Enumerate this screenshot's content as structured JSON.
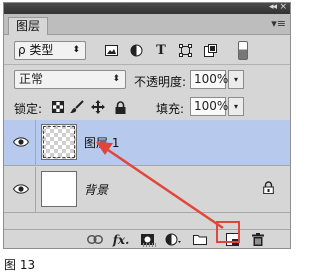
{
  "panel": {
    "tab_label": "图层",
    "collapse_glyph": "◂◂",
    "close_glyph": "×",
    "menu_glyph": "▾≡"
  },
  "filter": {
    "kind_label": "ρ 类型",
    "chevron": "⬍",
    "icons": [
      "image-filter-icon",
      "adjustment-filter-icon",
      "type-filter-icon",
      "shape-filter-icon",
      "smart-object-filter-icon"
    ]
  },
  "blend": {
    "mode": "正常",
    "chevron": "⬍",
    "opacity_label": "不透明度:",
    "opacity_value": "100%",
    "fill_label": "填充:",
    "fill_value": "100%",
    "dropdown_glyph": "▾"
  },
  "lock": {
    "label": "锁定:",
    "icons": [
      "lock-transparent-icon",
      "lock-brush-icon",
      "lock-move-icon",
      "lock-all-icon"
    ]
  },
  "layers": [
    {
      "name": "图层 1",
      "selected": true,
      "thumbnail": "transparent"
    },
    {
      "name": "背景",
      "selected": false,
      "thumbnail": "white",
      "locked": true
    }
  ],
  "bottom_bar": {
    "fx_label": "fx.",
    "icons": [
      "link-layers-icon",
      "fx-icon",
      "add-mask-icon",
      "adjustment-layer-icon",
      "new-group-icon",
      "new-layer-icon",
      "delete-icon"
    ]
  },
  "annotation_color": "#e2463b",
  "caption": "图 13"
}
